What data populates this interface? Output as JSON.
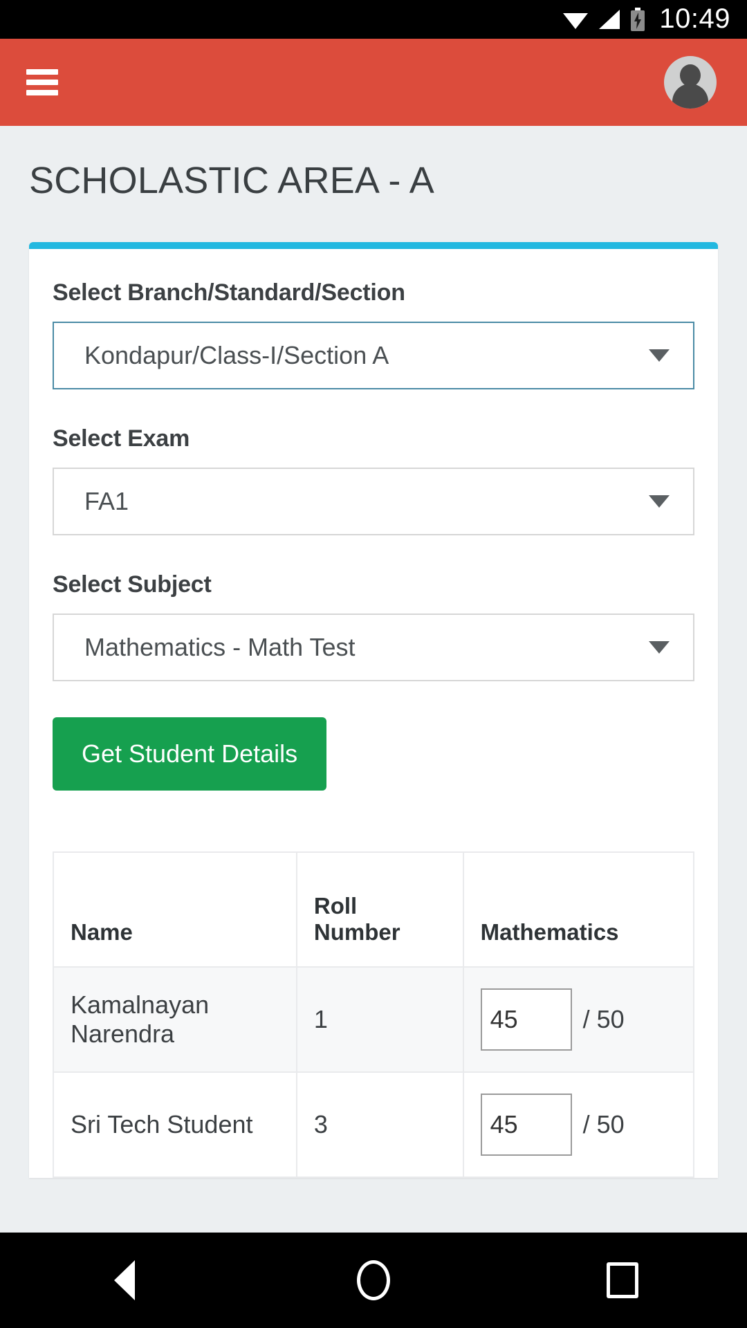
{
  "status_bar": {
    "time": "10:49",
    "icons": [
      "wifi-icon",
      "cellular-signal-icon",
      "battery-charging-icon"
    ]
  },
  "app_bar": {
    "menu_icon": "hamburger-menu-icon",
    "avatar_icon": "user-avatar-icon",
    "background_color": "#dc4c3c"
  },
  "page": {
    "title": "SCHOLASTIC AREA - A",
    "background_color": "#eceff1",
    "card_accent_color": "#22b8e0"
  },
  "form": {
    "branch": {
      "label": "Select Branch/Standard/Section",
      "value": "Kondapur/Class-I/Section A",
      "focused": true
    },
    "exam": {
      "label": "Select Exam",
      "value": "FA1",
      "focused": false
    },
    "subject": {
      "label": "Select Subject",
      "value": "Mathematics - Math Test",
      "focused": false
    },
    "submit_label": "Get Student Details",
    "submit_color": "#16a04f"
  },
  "table": {
    "headers": {
      "name": "Name",
      "roll": "Roll Number",
      "subject": "Mathematics"
    },
    "rows": [
      {
        "name": "Kamalnayan Narendra",
        "roll": "1",
        "score": "45",
        "max": "/ 50"
      },
      {
        "name": "Sri Tech Student",
        "roll": "3",
        "score": "45",
        "max": "/ 50"
      }
    ]
  },
  "nav_bar": {
    "back": "back-triangle-icon",
    "home": "home-circle-icon",
    "recents": "recents-square-icon"
  }
}
